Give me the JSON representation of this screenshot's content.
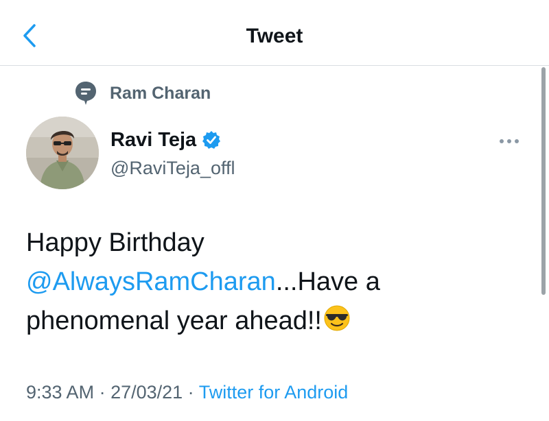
{
  "header": {
    "title": "Tweet"
  },
  "context": {
    "label": "Ram Charan"
  },
  "author": {
    "display_name": "Ravi Teja",
    "handle": "@RaviTeja_offl",
    "verified": true
  },
  "tweet": {
    "text_line1": "Happy Birthday",
    "mention": "@AlwaysRamCharan",
    "text_after_mention": "...Have a",
    "text_line3": "phenomenal year ahead!!",
    "emoji": "smiling-face-with-sunglasses"
  },
  "meta": {
    "time": "9:33 AM",
    "separator": " · ",
    "date": "27/03/21",
    "source": "Twitter for Android"
  },
  "colors": {
    "accent": "#1d9bf0",
    "secondary_text": "#536471",
    "primary_text": "#0f1419"
  },
  "icons": {
    "back": "chevron-left-icon",
    "context": "speech-bubble-icon",
    "verified": "verified-badge-icon",
    "more": "more-horizontal-icon"
  }
}
